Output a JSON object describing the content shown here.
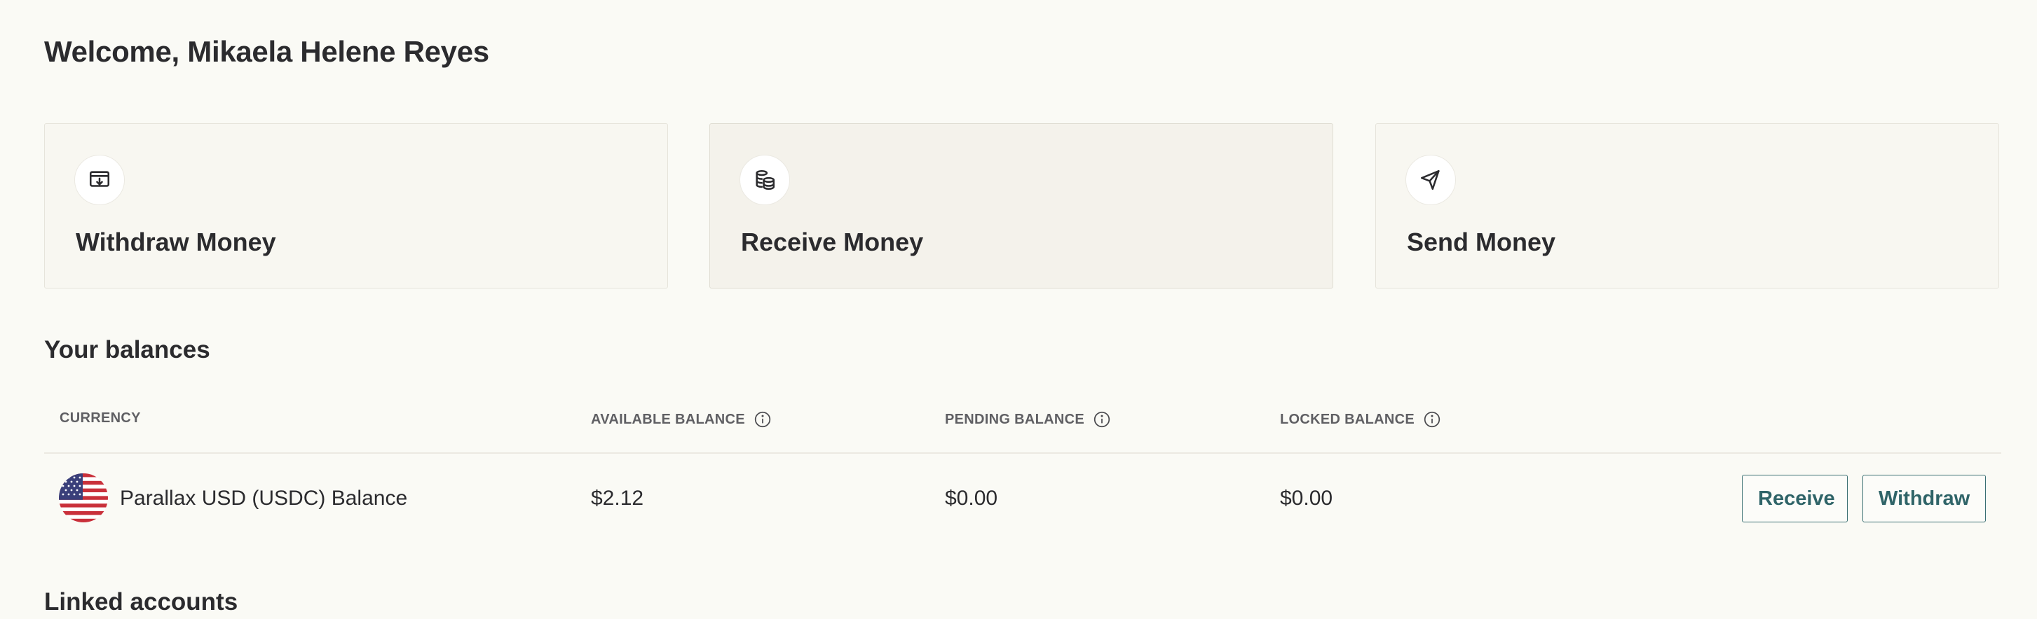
{
  "header": {
    "title": "Welcome, Mikaela Helene Reyes"
  },
  "actions": [
    {
      "label": "Withdraw Money",
      "icon": "withdraw-icon"
    },
    {
      "label": "Receive Money",
      "icon": "coins-icon"
    },
    {
      "label": "Send Money",
      "icon": "send-icon"
    }
  ],
  "balances": {
    "title": "Your balances",
    "columns": {
      "currency": "CURRENCY",
      "available": "AVAILABLE BALANCE",
      "pending": "PENDING BALANCE",
      "locked": "LOCKED BALANCE"
    },
    "rows": [
      {
        "flag_icon": "us-flag-icon",
        "currency": "Parallax USD (USDC) Balance",
        "available": "$2.12",
        "pending": "$0.00",
        "locked": "$0.00",
        "receive_label": "Receive",
        "withdraw_label": "Withdraw"
      }
    ]
  },
  "linked_accounts": {
    "title": "Linked accounts"
  },
  "colors": {
    "background": "#fafaf5",
    "accent": "#2f6468",
    "text": "#2b2b2e"
  }
}
